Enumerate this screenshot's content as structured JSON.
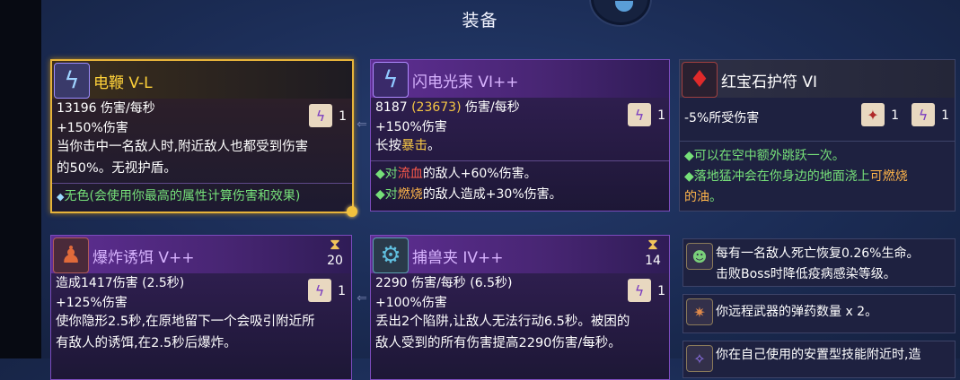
{
  "screen_title": "装备",
  "items": [
    {
      "name": "电鞭 V-L",
      "dps_line": "13196 伤害/每秒",
      "bonus_line": "+150%伤害",
      "scroll_count": "1",
      "desc_lines": [
        "当你击中一名敌人时,附近敌人也都受到伤害",
        "的50%。无视护盾。"
      ],
      "effect_prefix": "◆",
      "effect_text": "无色(会使用你最高的属性计算伤害和效果)"
    },
    {
      "name": "闪电光束 VI++",
      "dps_main": "8187",
      "dps_paren": "(23673)",
      "dps_tail": " 伤害/每秒",
      "bonus_line": "+150%伤害",
      "scroll_count": "1",
      "desc_pre": "长按",
      "desc_hi": "暴击",
      "desc_post": "。",
      "effects": [
        {
          "prefix": "◆对",
          "hi": "流血",
          "post": "的敌人+60%伤害。"
        },
        {
          "prefix": "◆对",
          "hi": "燃烧",
          "post": "的敌人造成+30%伤害。"
        }
      ]
    },
    {
      "name": "红宝石护符 VI",
      "stat_line": "-5%所受伤害",
      "scroll1_count": "1",
      "scroll2_count": "1",
      "effects": [
        {
          "text": "◆可以在空中额外跳跃一次。"
        },
        {
          "pre": "◆落地猛冲会在你身边的地面浇上",
          "hi": "可燃烧",
          "line2_hi": "的油",
          "post": "。"
        }
      ]
    },
    {
      "name": "爆炸诱饵 V++",
      "cooldown": "20",
      "dmg_line": "造成1417伤害 (2.5秒)",
      "bonus_line": "+125%伤害",
      "scroll_count": "1",
      "desc_lines": [
        "使你隐形2.5秒,在原地留下一个会吸引附近所",
        "有敌人的诱饵,在2.5秒后爆炸。"
      ]
    },
    {
      "name": "捕兽夹 IV++",
      "cooldown": "14",
      "dps_line": "2290 伤害/每秒 (6.5秒)",
      "bonus_line": "+100%伤害",
      "scroll_count": "1",
      "desc_lines": [
        "丢出2个陷阱,让敌人无法行动6.5秒。被困的",
        "敌人受到的所有伤害提高2290伤害/每秒。"
      ]
    }
  ],
  "mutations": [
    {
      "lines": [
        "每有一名敌人死亡恢复0.26%生命。",
        "击败Boss时降低疫病感染等级。"
      ]
    },
    {
      "lines": [
        "你远程武器的弹药数量 x 2。"
      ]
    },
    {
      "lines": [
        "你在自己使用的安置型技能附近时,造"
      ]
    }
  ],
  "colors": {
    "gold": "#e7b43a",
    "brutality_purple": "#7b4bbc",
    "effect_green": "#76e079",
    "highlight_red": "#ff5a4a",
    "highlight_orange": "#ffb54a"
  }
}
